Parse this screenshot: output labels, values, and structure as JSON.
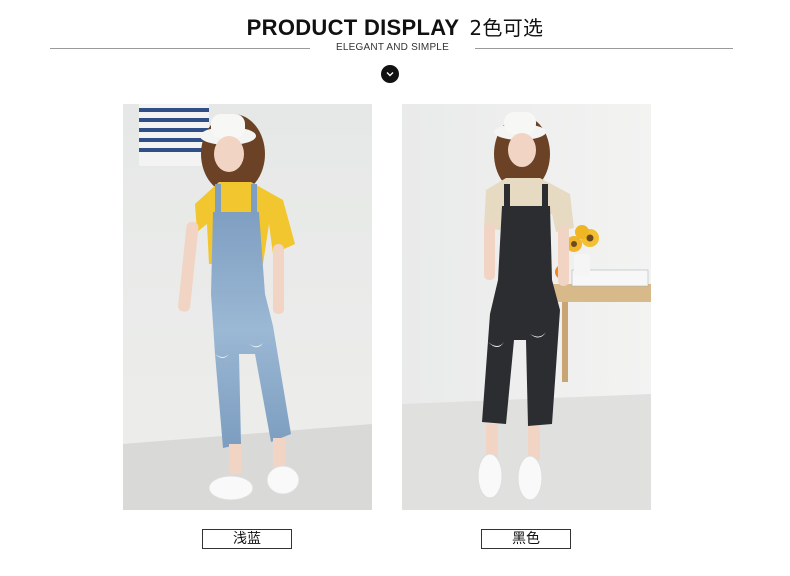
{
  "header": {
    "title": "PRODUCT DISPLAY",
    "title_cn": "2色可选",
    "subtitle": "ELEGANT AND SIMPLE",
    "scroll_icon": "chevron-down-icon"
  },
  "products": [
    {
      "caption": "浅蓝",
      "jeans_color": "#8fb0cf",
      "top_color": "#f2c62e"
    },
    {
      "caption": "黑色",
      "jeans_color": "#2b2d30",
      "top_color": "#e7dac3"
    }
  ]
}
